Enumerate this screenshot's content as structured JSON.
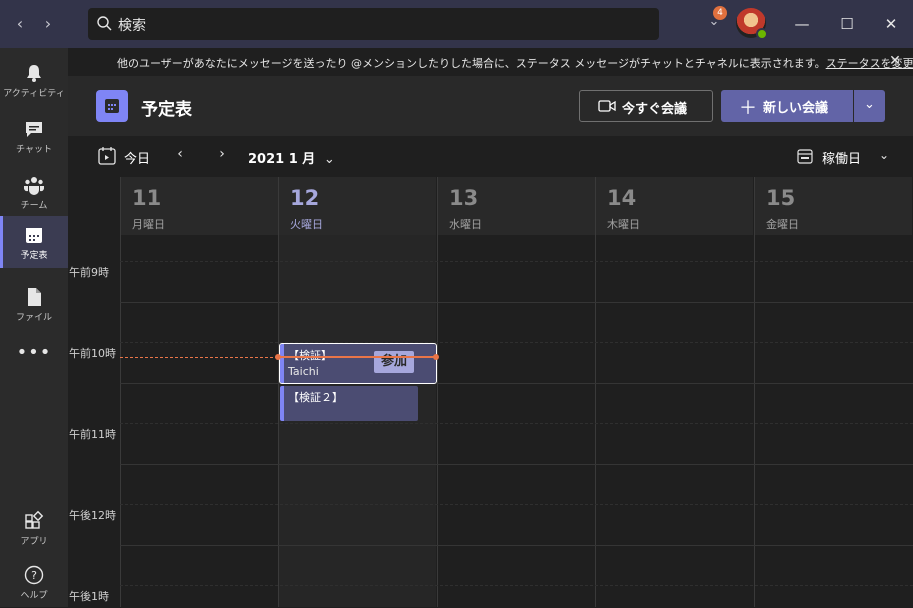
{
  "titlebar": {
    "search_text": "検索",
    "notification_count": "4"
  },
  "banner": {
    "message": "他のユーザーがあなたにメッセージを送ったり @メンションしたりした場合に、ステータス メッセージがチャットとチャネルに表示されます。",
    "link": "ステータスを変更する。"
  },
  "rail": {
    "items": [
      {
        "label": "アクティビティ",
        "icon": "bell-icon"
      },
      {
        "label": "チャット",
        "icon": "chat-icon"
      },
      {
        "label": "チーム",
        "icon": "teams-icon"
      },
      {
        "label": "予定表",
        "icon": "calendar-icon",
        "active": true
      },
      {
        "label": "ファイル",
        "icon": "file-icon"
      },
      {
        "label": "アプリ",
        "icon": "apps-icon"
      },
      {
        "label": "ヘルプ",
        "icon": "help-icon"
      }
    ]
  },
  "header": {
    "title": "予定表",
    "meet_now": "今すぐ会議",
    "new_meeting": "新しい会議"
  },
  "toolbar": {
    "today": "今日",
    "month": "2021 1 月",
    "view": "稼働日"
  },
  "days": [
    {
      "num": "11",
      "dow": "月曜日"
    },
    {
      "num": "12",
      "dow": "火曜日",
      "today": true
    },
    {
      "num": "13",
      "dow": "水曜日"
    },
    {
      "num": "14",
      "dow": "木曜日"
    },
    {
      "num": "15",
      "dow": "金曜日"
    }
  ],
  "times": [
    "午前9時",
    "午前10時",
    "午前11時",
    "午後12時",
    "午後1時"
  ],
  "events": [
    {
      "title": "【検証】",
      "organizer": "Taichi",
      "join": "参加"
    },
    {
      "title": "【検証２】"
    }
  ],
  "colors": {
    "accent": "#6264a7",
    "accent_light": "#7f85f5",
    "now_line": "#e97548",
    "presence": "#6bb700"
  }
}
